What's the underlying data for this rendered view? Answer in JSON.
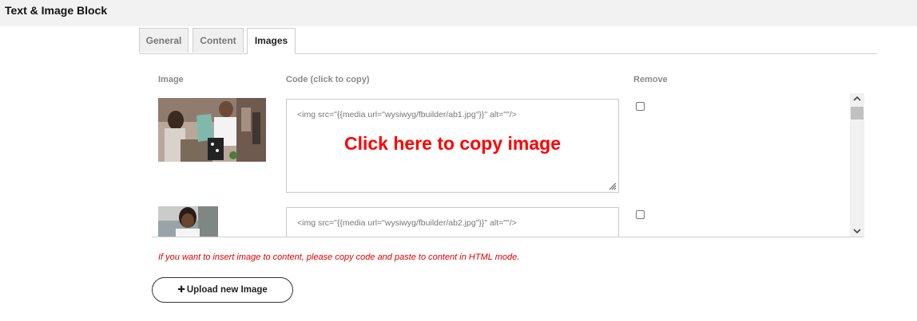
{
  "header": {
    "title": "Text & Image Block"
  },
  "tabs": [
    {
      "label": "General"
    },
    {
      "label": "Content"
    },
    {
      "label": "Images",
      "active": true
    }
  ],
  "table": {
    "columns": {
      "image": "Image",
      "code": "Code (click to copy)",
      "remove": "Remove"
    },
    "rows": [
      {
        "code": "<img src=\"{{media url=\"wysiwyg/fbuilder/ab1.jpg\"}}\" alt=\"\"/>",
        "copy_label": "Click here to copy image",
        "remove": false
      },
      {
        "code": "<img src=\"{{media url=\"wysiwyg/fbuilder/ab2.jpg\"}}\" alt=\"\"/>",
        "remove": false
      }
    ]
  },
  "hint": "If you want to insert image to content, please copy code and paste to content in HTML mode.",
  "upload_button": {
    "label": "Upload new Image",
    "icon": "plus-icon"
  },
  "colors": {
    "hint": "#e00000",
    "copy_overlay": "#ff0000"
  }
}
